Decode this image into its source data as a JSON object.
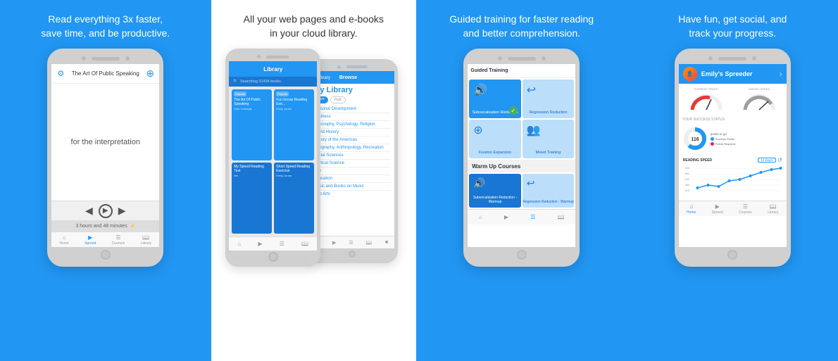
{
  "panels": [
    {
      "id": "panel1",
      "tagline": "Read everything 3x faster,\nsave time, and be productive.",
      "bg": "#2196F3",
      "phone": {
        "header_title": "The Art Of Public Speaking",
        "content_word": "for the interpretation",
        "time_text": "3 hours and 48 minutes",
        "nav_items": [
          "Home",
          "Spreed",
          "Courses",
          "Library"
        ]
      }
    },
    {
      "id": "panel2",
      "tagline": "All your web pages and e-books\nin your cloud library.",
      "bg": "#FFFFFF",
      "library": {
        "title": "Library",
        "search_placeholder": "Searching 31434 books",
        "cards": [
          {
            "tag": "Popular",
            "title": "The Art Of Public Speaking",
            "author": "Dale Carnegie"
          },
          {
            "tag": "Popular",
            "title": "Fun Group Reading Exe...",
            "author": "Emily Jones"
          },
          {
            "tag": "",
            "title": "My Speed Reading Test",
            "author": "Me"
          },
          {
            "tag": "",
            "title": "Short Speed Reading Exercise",
            "author": "Emily Jones"
          }
        ]
      },
      "browse": {
        "title": "Browse",
        "subtitle": "My Library",
        "filters": [
          "Free",
          "Paid"
        ],
        "categories": [
          "Personal Development",
          "Business",
          "Philosophy, Psychology, Religion",
          "World History",
          "History of the Americas",
          "Geography, Anthropology, Recreation",
          "Social Sciences",
          "Political Science",
          "Law",
          "Education",
          "Music and Books on Music",
          "Fine Arts"
        ]
      }
    },
    {
      "id": "panel3",
      "tagline": "Guided training for faster reading\nand better comprehension.",
      "bg": "#2196F3",
      "training": {
        "guided_title": "Guided Training",
        "cards": [
          {
            "label": "Subvocalization Reduction",
            "icon": "🔊",
            "checked": true
          },
          {
            "label": "Regression Reduction",
            "icon": "↩",
            "checked": false
          },
          {
            "label": "Fixation Expansion",
            "icon": "⊕",
            "checked": false
          },
          {
            "label": "Mixed Training",
            "icon": "👥",
            "checked": false
          }
        ],
        "warmup_title": "Warm Up Courses",
        "warmup_cards": [
          {
            "label": "Subvocalization Reduction - Warmup",
            "icon": "🔊"
          },
          {
            "label": "Regression Reduction - Warmup",
            "icon": "↩"
          }
        ]
      }
    },
    {
      "id": "panel4",
      "tagline": "Have fun, get social, and\ntrack your progress.",
      "bg": "#2196F3",
      "social": {
        "user_name": "Emily's Spreeder",
        "current_speed_label": "CURRENT SPEED",
        "target_speed_label": "TARGET SPEED",
        "success_status_label": "YOUR SUCCESS STATUS",
        "points_value": "116",
        "points_label": "points to go",
        "legend": [
          {
            "color": "#2196F3",
            "label": "Success Points"
          },
          {
            "color": "#E91E63",
            "label": "Points Required"
          }
        ],
        "reading_speed_label": "READING SPEED",
        "chart_period": "14 Days",
        "y_labels": [
          "510",
          "460",
          "410",
          "360",
          "310"
        ],
        "nav_items": [
          "Home",
          "Spreed",
          "Courses",
          "Library"
        ]
      }
    }
  ]
}
